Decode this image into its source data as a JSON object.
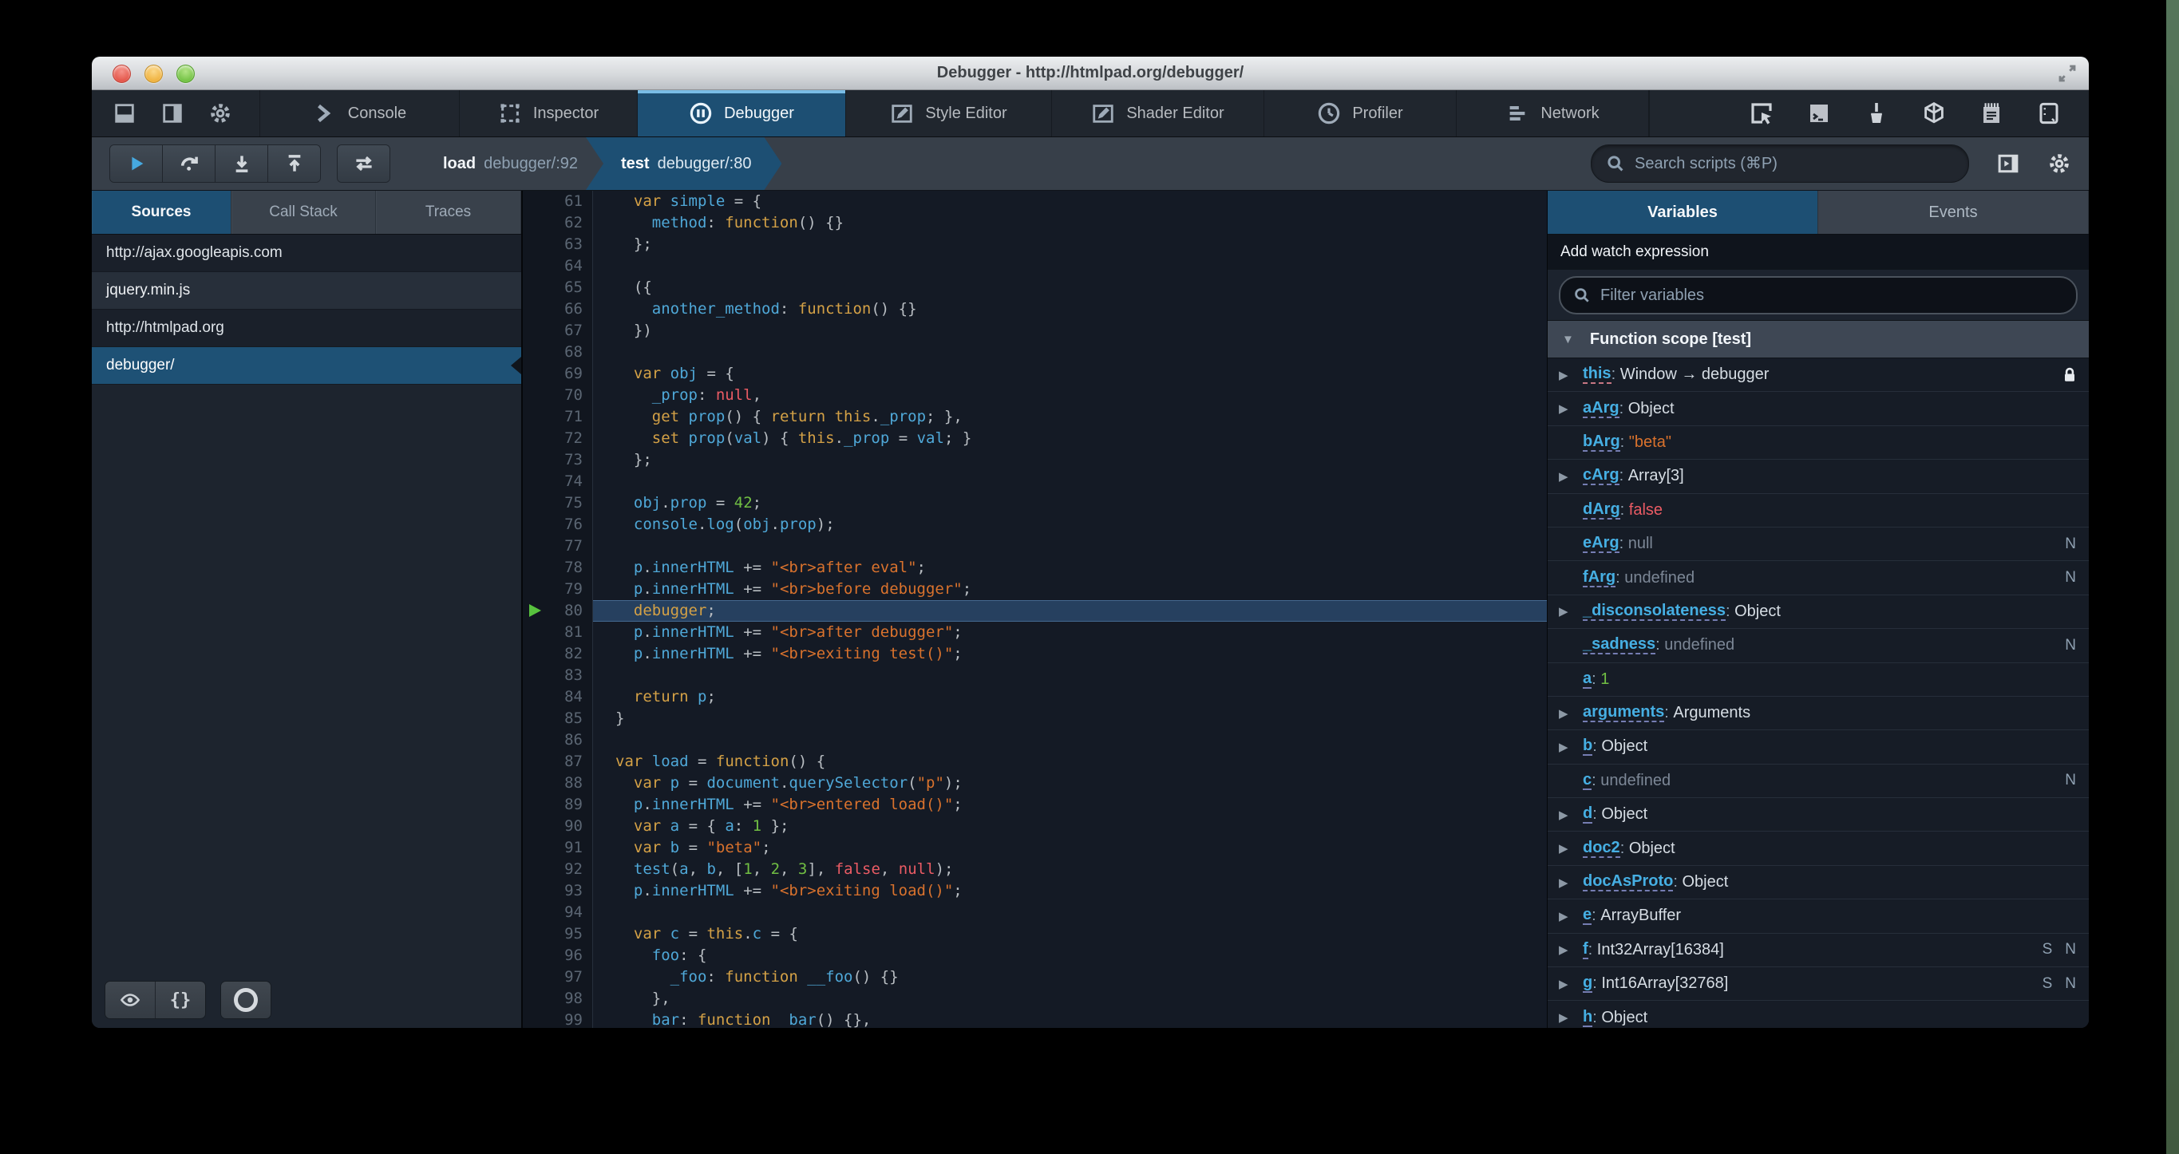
{
  "window": {
    "title": "Debugger - http://htmlpad.org/debugger/"
  },
  "toolbar": {
    "left_icons": [
      "dock-bottom",
      "dock-side",
      "gear"
    ],
    "tabs": [
      {
        "label": "Console",
        "icon": "console-prompt",
        "active": false
      },
      {
        "label": "Inspector",
        "icon": "inspector-select",
        "active": false
      },
      {
        "label": "Debugger",
        "icon": "debugger-pause",
        "active": true
      },
      {
        "label": "Style Editor",
        "icon": "style-editor-pen",
        "active": false
      },
      {
        "label": "Shader Editor",
        "icon": "shader-editor-pen",
        "active": false
      },
      {
        "label": "Profiler",
        "icon": "profiler-clock",
        "active": false
      },
      {
        "label": "Network",
        "icon": "network-bars",
        "active": false
      }
    ],
    "right_icons": [
      "pick-element",
      "split-console",
      "paintbrush",
      "tilt-3d",
      "scratchpad",
      "responsive-mode"
    ]
  },
  "command_bar": {
    "buttons": [
      "resume",
      "step-over",
      "step-in",
      "step-out"
    ],
    "blackbox_button": "toggle-black-boxing",
    "breadcrumbs": [
      {
        "fn": "load",
        "loc": "debugger/:92",
        "active": false
      },
      {
        "fn": "test",
        "loc": "debugger/:80",
        "active": true
      }
    ],
    "search_placeholder": "Search scripts (⌘P)"
  },
  "sidebar": {
    "tabs": [
      {
        "label": "Sources",
        "active": true
      },
      {
        "label": "Call Stack",
        "active": false
      },
      {
        "label": "Traces",
        "active": false
      }
    ],
    "sources": [
      {
        "label": "http://ajax.googleapis.com",
        "kind": "group",
        "selected": false
      },
      {
        "label": "jquery.min.js",
        "kind": "item",
        "selected": false
      },
      {
        "label": "http://htmlpad.org",
        "kind": "group",
        "selected": false
      },
      {
        "label": "debugger/",
        "kind": "item",
        "selected": true
      }
    ],
    "footer_buttons": [
      "blackbox-eye",
      "pretty-print",
      "pause-on-exceptions"
    ]
  },
  "editor": {
    "first_line": 61,
    "current_line": 80,
    "lines": [
      [
        [
          "p",
          "  "
        ],
        [
          "k",
          "var"
        ],
        [
          "p",
          " "
        ],
        [
          "v",
          "simple"
        ],
        [
          "p",
          " = {"
        ]
      ],
      [
        [
          "p",
          "    "
        ],
        [
          "v",
          "method"
        ],
        [
          "p",
          ": "
        ],
        [
          "k",
          "function"
        ],
        [
          "p",
          "() {}"
        ]
      ],
      [
        [
          "p",
          "  };"
        ]
      ],
      [],
      [
        [
          "p",
          "  ({"
        ]
      ],
      [
        [
          "p",
          "    "
        ],
        [
          "v",
          "another_method"
        ],
        [
          "p",
          ": "
        ],
        [
          "k",
          "function"
        ],
        [
          "p",
          "() {}"
        ]
      ],
      [
        [
          "p",
          "  })"
        ]
      ],
      [],
      [
        [
          "p",
          "  "
        ],
        [
          "k",
          "var"
        ],
        [
          "p",
          " "
        ],
        [
          "v",
          "obj"
        ],
        [
          "p",
          " = {"
        ]
      ],
      [
        [
          "p",
          "    "
        ],
        [
          "v",
          "_prop"
        ],
        [
          "p",
          ": "
        ],
        [
          "x",
          "null"
        ],
        [
          "p",
          ","
        ]
      ],
      [
        [
          "p",
          "    "
        ],
        [
          "k",
          "get"
        ],
        [
          "p",
          " "
        ],
        [
          "v",
          "prop"
        ],
        [
          "p",
          "() { "
        ],
        [
          "k",
          "return"
        ],
        [
          "p",
          " "
        ],
        [
          "k",
          "this"
        ],
        [
          "p",
          "."
        ],
        [
          "v",
          "_prop"
        ],
        [
          "p",
          "; },"
        ]
      ],
      [
        [
          "p",
          "    "
        ],
        [
          "k",
          "set"
        ],
        [
          "p",
          " "
        ],
        [
          "v",
          "prop"
        ],
        [
          "p",
          "("
        ],
        [
          "v",
          "val"
        ],
        [
          "p",
          ") { "
        ],
        [
          "k",
          "this"
        ],
        [
          "p",
          "."
        ],
        [
          "v",
          "_prop"
        ],
        [
          "p",
          " = "
        ],
        [
          "v",
          "val"
        ],
        [
          "p",
          "; }"
        ]
      ],
      [
        [
          "p",
          "  };"
        ]
      ],
      [],
      [
        [
          "p",
          "  "
        ],
        [
          "v",
          "obj"
        ],
        [
          "p",
          "."
        ],
        [
          "v",
          "prop"
        ],
        [
          "p",
          " = "
        ],
        [
          "n",
          "42"
        ],
        [
          "p",
          ";"
        ]
      ],
      [
        [
          "p",
          "  "
        ],
        [
          "v",
          "console"
        ],
        [
          "p",
          "."
        ],
        [
          "v",
          "log"
        ],
        [
          "p",
          "("
        ],
        [
          "v",
          "obj"
        ],
        [
          "p",
          "."
        ],
        [
          "v",
          "prop"
        ],
        [
          "p",
          ");"
        ]
      ],
      [],
      [
        [
          "p",
          "  "
        ],
        [
          "v",
          "p"
        ],
        [
          "p",
          "."
        ],
        [
          "v",
          "innerHTML"
        ],
        [
          "p",
          " += "
        ],
        [
          "s",
          "\"<br>after eval\""
        ],
        [
          "p",
          ";"
        ]
      ],
      [
        [
          "p",
          "  "
        ],
        [
          "v",
          "p"
        ],
        [
          "p",
          "."
        ],
        [
          "v",
          "innerHTML"
        ],
        [
          "p",
          " += "
        ],
        [
          "s",
          "\"<br>before debugger\""
        ],
        [
          "p",
          ";"
        ]
      ],
      [
        [
          "p",
          "  "
        ],
        [
          "k",
          "debugger"
        ],
        [
          "p",
          ";"
        ]
      ],
      [
        [
          "p",
          "  "
        ],
        [
          "v",
          "p"
        ],
        [
          "p",
          "."
        ],
        [
          "v",
          "innerHTML"
        ],
        [
          "p",
          " += "
        ],
        [
          "s",
          "\"<br>after debugger\""
        ],
        [
          "p",
          ";"
        ]
      ],
      [
        [
          "p",
          "  "
        ],
        [
          "v",
          "p"
        ],
        [
          "p",
          "."
        ],
        [
          "v",
          "innerHTML"
        ],
        [
          "p",
          " += "
        ],
        [
          "s",
          "\"<br>exiting test()\""
        ],
        [
          "p",
          ";"
        ]
      ],
      [],
      [
        [
          "p",
          "  "
        ],
        [
          "k",
          "return"
        ],
        [
          "p",
          " "
        ],
        [
          "v",
          "p"
        ],
        [
          "p",
          ";"
        ]
      ],
      [
        [
          "p",
          "}"
        ]
      ],
      [],
      [
        [
          "k",
          "var"
        ],
        [
          "p",
          " "
        ],
        [
          "v",
          "load"
        ],
        [
          "p",
          " = "
        ],
        [
          "k",
          "function"
        ],
        [
          "p",
          "() {"
        ]
      ],
      [
        [
          "p",
          "  "
        ],
        [
          "k",
          "var"
        ],
        [
          "p",
          " "
        ],
        [
          "v",
          "p"
        ],
        [
          "p",
          " = "
        ],
        [
          "v",
          "document"
        ],
        [
          "p",
          "."
        ],
        [
          "v",
          "querySelector"
        ],
        [
          "p",
          "("
        ],
        [
          "s",
          "\"p\""
        ],
        [
          "p",
          ");"
        ]
      ],
      [
        [
          "p",
          "  "
        ],
        [
          "v",
          "p"
        ],
        [
          "p",
          "."
        ],
        [
          "v",
          "innerHTML"
        ],
        [
          "p",
          " += "
        ],
        [
          "s",
          "\"<br>entered load()\""
        ],
        [
          "p",
          ";"
        ]
      ],
      [
        [
          "p",
          "  "
        ],
        [
          "k",
          "var"
        ],
        [
          "p",
          " "
        ],
        [
          "v",
          "a"
        ],
        [
          "p",
          " = { "
        ],
        [
          "v",
          "a"
        ],
        [
          "p",
          ": "
        ],
        [
          "n",
          "1"
        ],
        [
          "p",
          " };"
        ]
      ],
      [
        [
          "p",
          "  "
        ],
        [
          "k",
          "var"
        ],
        [
          "p",
          " "
        ],
        [
          "v",
          "b"
        ],
        [
          "p",
          " = "
        ],
        [
          "s",
          "\"beta\""
        ],
        [
          "p",
          ";"
        ]
      ],
      [
        [
          "p",
          "  "
        ],
        [
          "v",
          "test"
        ],
        [
          "p",
          "("
        ],
        [
          "v",
          "a"
        ],
        [
          "p",
          ", "
        ],
        [
          "v",
          "b"
        ],
        [
          "p",
          ", ["
        ],
        [
          "n",
          "1"
        ],
        [
          "p",
          ", "
        ],
        [
          "n",
          "2"
        ],
        [
          "p",
          ", "
        ],
        [
          "n",
          "3"
        ],
        [
          "p",
          "], "
        ],
        [
          "x",
          "false"
        ],
        [
          "p",
          ", "
        ],
        [
          "x",
          "null"
        ],
        [
          "p",
          ");"
        ]
      ],
      [
        [
          "p",
          "  "
        ],
        [
          "v",
          "p"
        ],
        [
          "p",
          "."
        ],
        [
          "v",
          "innerHTML"
        ],
        [
          "p",
          " += "
        ],
        [
          "s",
          "\"<br>exiting load()\""
        ],
        [
          "p",
          ";"
        ]
      ],
      [],
      [
        [
          "p",
          "  "
        ],
        [
          "k",
          "var"
        ],
        [
          "p",
          " "
        ],
        [
          "v",
          "c"
        ],
        [
          "p",
          " = "
        ],
        [
          "k",
          "this"
        ],
        [
          "p",
          "."
        ],
        [
          "v",
          "c"
        ],
        [
          "p",
          " = {"
        ]
      ],
      [
        [
          "p",
          "    "
        ],
        [
          "v",
          "foo"
        ],
        [
          "p",
          ": {"
        ]
      ],
      [
        [
          "p",
          "      "
        ],
        [
          "v",
          "_foo"
        ],
        [
          "p",
          ": "
        ],
        [
          "k",
          "function"
        ],
        [
          "p",
          " "
        ],
        [
          "v",
          "__foo"
        ],
        [
          "p",
          "() {}"
        ]
      ],
      [
        [
          "p",
          "    },"
        ]
      ],
      [
        [
          "p",
          "    "
        ],
        [
          "v",
          "bar"
        ],
        [
          "p",
          ": "
        ],
        [
          "k",
          "function"
        ],
        [
          "p",
          "  "
        ],
        [
          "v",
          "bar"
        ],
        [
          "p",
          "() {},"
        ]
      ]
    ]
  },
  "variables_panel": {
    "tabs": [
      {
        "label": "Variables",
        "active": true
      },
      {
        "label": "Events",
        "active": false
      }
    ],
    "watch_label": "Add watch expression",
    "filter_placeholder": "Filter variables",
    "scope": {
      "label": "Function scope [test]"
    },
    "variables": [
      {
        "name": "this",
        "value": "Window → debugger",
        "vtype": "plain",
        "expandable": true,
        "lock": true,
        "pink_underline": true,
        "badges": []
      },
      {
        "name": "aArg",
        "value": "Object",
        "vtype": "plain",
        "expandable": true,
        "badges": []
      },
      {
        "name": "bArg",
        "value": "\"beta\"",
        "vtype": "string",
        "expandable": false,
        "badges": []
      },
      {
        "name": "cArg",
        "value": "Array[3]",
        "vtype": "plain",
        "expandable": true,
        "badges": []
      },
      {
        "name": "dArg",
        "value": "false",
        "vtype": "boolean",
        "expandable": false,
        "badges": []
      },
      {
        "name": "eArg",
        "value": "null",
        "vtype": "dim",
        "expandable": false,
        "badges": [
          "N"
        ]
      },
      {
        "name": "fArg",
        "value": "undefined",
        "vtype": "dim",
        "expandable": false,
        "badges": [
          "N"
        ]
      },
      {
        "name": "_disconsolateness",
        "value": "Object",
        "vtype": "plain",
        "expandable": true,
        "badges": []
      },
      {
        "name": "_sadness",
        "value": "undefined",
        "vtype": "dim",
        "expandable": false,
        "badges": [
          "N"
        ]
      },
      {
        "name": "a",
        "value": "1",
        "vtype": "number",
        "expandable": false,
        "badges": []
      },
      {
        "name": "arguments",
        "value": "Arguments",
        "vtype": "plain",
        "expandable": true,
        "badges": []
      },
      {
        "name": "b",
        "value": "Object",
        "vtype": "plain",
        "expandable": true,
        "badges": []
      },
      {
        "name": "c",
        "value": "undefined",
        "vtype": "dim",
        "expandable": false,
        "badges": [
          "N"
        ]
      },
      {
        "name": "d",
        "value": "Object",
        "vtype": "plain",
        "expandable": true,
        "badges": []
      },
      {
        "name": "doc2",
        "value": "Object",
        "vtype": "plain",
        "expandable": true,
        "badges": []
      },
      {
        "name": "docAsProto",
        "value": "Object",
        "vtype": "plain",
        "expandable": true,
        "badges": []
      },
      {
        "name": "e",
        "value": "ArrayBuffer",
        "vtype": "plain",
        "expandable": true,
        "badges": []
      },
      {
        "name": "f",
        "value": "Int32Array[16384]",
        "vtype": "plain",
        "expandable": true,
        "badges": [
          "S",
          "N"
        ]
      },
      {
        "name": "g",
        "value": "Int16Array[32768]",
        "vtype": "plain",
        "expandable": true,
        "badges": [
          "S",
          "N"
        ]
      },
      {
        "name": "h",
        "value": "Object",
        "vtype": "plain",
        "expandable": true,
        "badges": []
      }
    ]
  },
  "colors": {
    "accent_blue": "#1d4f73",
    "tab_highlight": "#79bde6",
    "keyword": "#d4a146",
    "identifier": "#4fa8d8",
    "string": "#d9722d",
    "number": "#71bf43",
    "null_false": "#ea5b64",
    "variable_name": "#46afe3",
    "exec_arrow_green": "#58c23e"
  }
}
